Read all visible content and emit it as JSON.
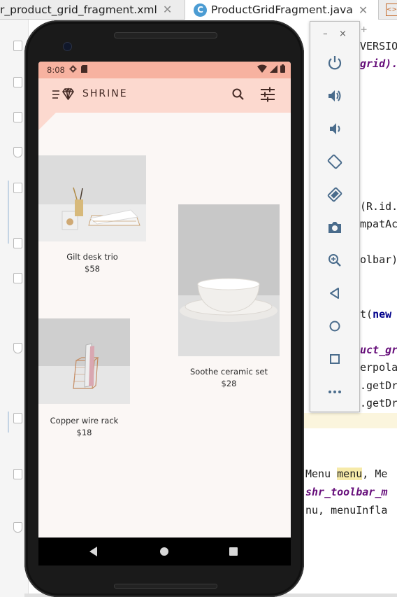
{
  "ide": {
    "tabs": [
      {
        "label": "r_product_grid_fragment.xml",
        "close": "✕",
        "active": false
      },
      {
        "label": "ProductGridFragment.java",
        "close": "✕",
        "active": true,
        "badge": "C"
      }
    ],
    "code_fragments": [
      {
        "text": "r 23+",
        "style": "gray"
      },
      {
        "text": "VERSIO",
        "style": "plain"
      },
      {
        "text": "grid).",
        "style": "it"
      },
      {
        "text": "(R.id.",
        "style": "plain"
      },
      {
        "text": "mpatAc",
        "style": "plain"
      },
      {
        "text": "olbar)",
        "style": "plain"
      },
      {
        "text": "t(",
        "style": "plain"
      },
      {
        "text": "new",
        "style": "kw"
      },
      {
        "text": "uct_gr",
        "style": "it"
      },
      {
        "text": "erpola",
        "style": "plain"
      },
      {
        "text": ".getDr",
        "style": "plain"
      },
      {
        "text": ".getDr",
        "style": "plain"
      },
      {
        "text": "Menu ",
        "style": "plain"
      },
      {
        "text": "menu",
        "style": "hl"
      },
      {
        "text": ", Me",
        "style": "plain"
      },
      {
        "text": "shr_toolbar_m",
        "style": "it"
      },
      {
        "text": "nu, menuInfla",
        "style": "plain"
      }
    ]
  },
  "phone": {
    "status_bar": {
      "time": "8:08",
      "icons": [
        "settings-icon",
        "sd-card-icon",
        "wifi-icon",
        "signal-icon",
        "battery-icon"
      ]
    },
    "toolbar": {
      "title": "SHRINE",
      "menu_icon": "menu-icon",
      "logo_icon": "diamond-logo-icon",
      "search_icon": "search-icon",
      "filter_icon": "tune-icon"
    },
    "products": [
      {
        "title": "Gilt desk trio",
        "price": "$58"
      },
      {
        "title": "Soothe ceramic set",
        "price": "$28"
      },
      {
        "title": "Copper wire rack",
        "price": "$18"
      }
    ],
    "nav_bar": {
      "back": "back-icon",
      "home": "home-icon",
      "recents": "recents-icon"
    }
  },
  "emulator_panel": {
    "minimize": "–",
    "close": "×",
    "controls": [
      "power-icon",
      "volume-up-icon",
      "volume-down-icon",
      "rotate-left-icon",
      "rotate-right-icon",
      "screenshot-icon",
      "zoom-icon",
      "back-icon",
      "home-icon",
      "overview-icon",
      "more-icon"
    ]
  },
  "colors": {
    "status_bar": "#f7b2a0",
    "toolbar": "#fcd9cf",
    "screen_bg": "#fbf7f5",
    "text_dark": "#442a25"
  }
}
